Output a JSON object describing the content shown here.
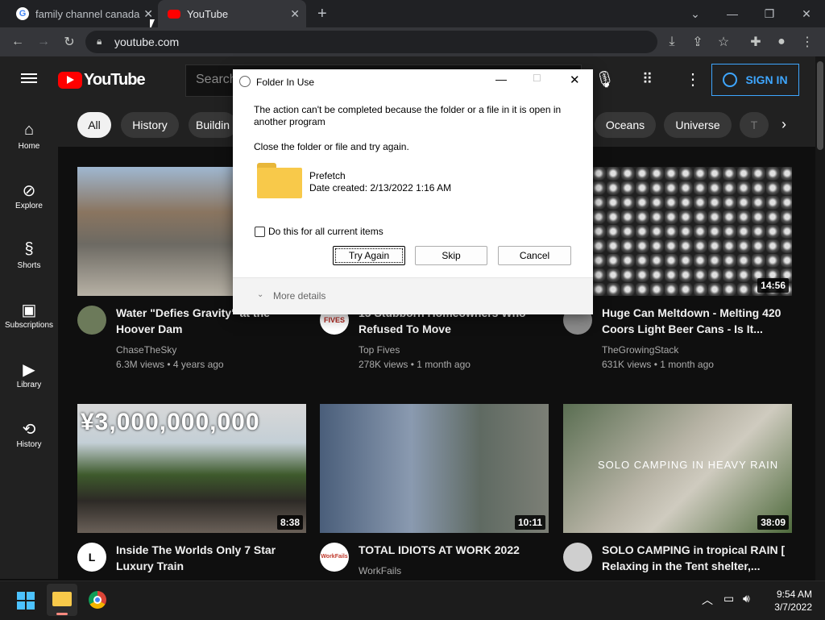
{
  "browser": {
    "tabs": [
      {
        "label": "family channel canada"
      },
      {
        "label": "YouTube"
      }
    ],
    "url": "youtube.com"
  },
  "youtube": {
    "logo": "YouTube",
    "search_placeholder": "Search",
    "sign_in": "SIGN IN",
    "chips": [
      "All",
      "History",
      "Buildin",
      "Oceans",
      "Universe",
      "T"
    ],
    "guide": [
      {
        "label": "Home",
        "icon": "home-icon"
      },
      {
        "label": "Explore",
        "icon": "compass-icon"
      },
      {
        "label": "Shorts",
        "icon": "shorts-icon"
      },
      {
        "label": "Subscriptions",
        "icon": "subscriptions-icon"
      },
      {
        "label": "Library",
        "icon": "library-icon"
      },
      {
        "label": "History",
        "icon": "history-icon"
      }
    ],
    "videos": [
      {
        "title": "Water \"Defies Gravity\" at the Hoover Dam",
        "channel": "ChaseTheSky",
        "meta": "6.3M views • 4 years ago",
        "duration": ""
      },
      {
        "title": "15 Stubborn Homeowners Who Refused To Move",
        "channel": "Top Fives",
        "meta": "278K views • 1 month ago",
        "duration": ""
      },
      {
        "title": "Huge Can Meltdown - Melting 420 Coors Light Beer Cans - Is It...",
        "channel": "TheGrowingStack",
        "meta": "631K views • 1 month ago",
        "duration": "14:56"
      },
      {
        "title": "Inside The Worlds Only 7 Star Luxury Train",
        "channel": "",
        "meta": "",
        "duration": "8:38",
        "thumb_text": "¥3,000,000,000"
      },
      {
        "title": "TOTAL IDIOTS AT WORK 2022",
        "channel": "WorkFails",
        "meta": "",
        "duration": "10:11"
      },
      {
        "title": "SOLO CAMPING in tropical RAIN [ Relaxing in the Tent shelter,...",
        "channel": "",
        "meta": "",
        "duration": "38:09",
        "thumb_text": "SOLO CAMPING IN HEAVY RAIN"
      }
    ]
  },
  "dialog": {
    "title": "Folder In Use",
    "message": "The action can't be completed because the folder or a file in it is open in another program",
    "instruction": "Close the folder or file and try again.",
    "item_name": "Prefetch",
    "item_date": "Date created: 2/13/2022 1:16 AM",
    "checkbox_label": "Do this for all current items",
    "buttons": {
      "try_again": "Try Again",
      "skip": "Skip",
      "cancel": "Cancel"
    },
    "more_details": "More details"
  },
  "taskbar": {
    "time": "9:54 AM",
    "date": "3/7/2022"
  },
  "colors": {
    "youtube_red": "#ff0000",
    "signin_blue": "#3ea6ff",
    "folder_yellow": "#f8c94a"
  }
}
